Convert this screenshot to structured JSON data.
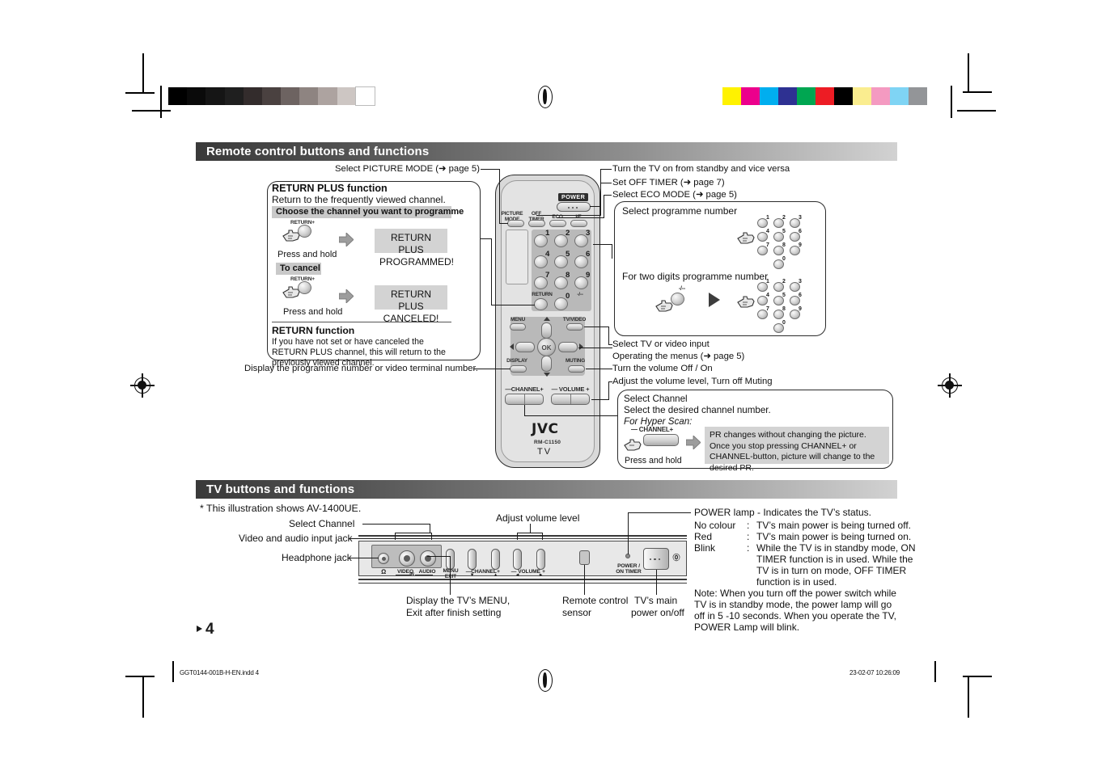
{
  "page": {
    "number": "4",
    "footer_file": "GGT0144-001B-H-EN.indd   4",
    "footer_timestamp": "23-02-07   10:26:09"
  },
  "sections": {
    "remote": {
      "title": "Remote control buttons and functions"
    },
    "tv": {
      "title": "TV buttons and functions"
    }
  },
  "remote_callouts": {
    "picture_mode": "Select PICTURE MODE (➜ page 5)",
    "power": "Turn the TV on from standby and vice versa",
    "off_timer": "Set OFF TIMER (➜ page 7)",
    "eco_mode": "Select ECO MODE (➜ page 5)",
    "tv_video": "Select TV or video input",
    "menus": "Operating the menus (➜ page 5)",
    "muting": "Turn the volume Off / On",
    "volume": "Adjust the volume level, Turn off Muting",
    "display": "Display the programme number or video terminal number."
  },
  "return_plus_box": {
    "title": "RETURN PLUS function",
    "subtitle": "Return to the frequently viewed channel.",
    "band_choose": "Choose the channel you want to programme",
    "btn_label_1": "RETURN+",
    "press_hold_1": "Press and hold",
    "result_1_line1": "RETURN PLUS",
    "result_1_line2": "PROGRAMMED!",
    "band_cancel": "To cancel",
    "btn_label_2": "RETURN+",
    "press_hold_2": "Press and hold",
    "result_2_line1": "RETURN PLUS",
    "result_2_line2": "CANCELED!",
    "return_title": "RETURN function",
    "return_text": "If you have not set or have canceled the RETURN PLUS channel, this will return to the previously viewed channel."
  },
  "programme_box": {
    "title": "Select programme number",
    "two_digit_title": "For two digits programme number",
    "dash_key_label": "-/--",
    "keypad_digits": [
      "1",
      "2",
      "3",
      "4",
      "5",
      "6",
      "7",
      "8",
      "9",
      "0"
    ]
  },
  "channel_box": {
    "title": "Select Channel",
    "subtitle": "Select the desired channel number.",
    "hyper_scan": "For Hyper Scan:",
    "rocker_label": "— CHANNEL+",
    "press_hold": "Press and hold",
    "note": "PR changes without changing the picture. Once you stop pressing CHANNEL+ or CHANNEL-button, picture will change to the desired PR."
  },
  "remote_keys": {
    "power_tag": "POWER",
    "picture_mode_l1": "PICTURE",
    "picture_mode_l2": "MODE",
    "off_timer_l1": "OFF",
    "off_timer_l2": "TIMER",
    "eco": "ECO",
    "ie": "I/E",
    "return": "RETURN",
    "dash": "-/--",
    "menu": "MENU",
    "tv_video": "TV/VIDEO",
    "display": "DISPLAY",
    "muting": "MUTING",
    "ok": "OK",
    "channel_rocker": "—CHANNEL+",
    "volume_rocker": "— VOLUME +",
    "brand": "JVC",
    "model": "RM-C1150",
    "type": "TV",
    "digits": [
      {
        "d": "1"
      },
      {
        "d": "2"
      },
      {
        "d": "3"
      },
      {
        "d": "4"
      },
      {
        "d": "5"
      },
      {
        "d": "6"
      },
      {
        "d": "7"
      },
      {
        "d": "8"
      },
      {
        "d": "9"
      },
      {
        "d": "0"
      }
    ]
  },
  "tv_section": {
    "illustration_note": "* This illustration shows AV-1400UE.",
    "label_select_channel": "Select Channel",
    "label_video_audio": "Video and audio input jack",
    "label_headphone": "Headphone jack",
    "label_adjust_volume": "Adjust volume level",
    "label_menu_l1": "Display the TV’s MENU,",
    "label_menu_l2": "Exit after finish setting",
    "label_sensor_l1": "Remote control",
    "label_sensor_l2": "sensor",
    "label_mainpower_l1": "TV’s main",
    "label_mainpower_l2": "power on/off",
    "panel_labels": {
      "headphone_icon": "Ω",
      "video": "VIDEO",
      "in": "IN",
      "audio": "AUDIO",
      "menu_l1": "MENU",
      "menu_l2": "EXIT",
      "channel": "CHANNEL",
      "channel_minus": "—",
      "channel_plus": "+",
      "channel_down": "▼",
      "channel_up": "▲",
      "volume": "VOLUME",
      "volume_minus": "—",
      "volume_plus": "+",
      "volume_left": "◄",
      "volume_right": "►",
      "power_l1": "POWER /",
      "power_l2": "ON TIMER",
      "power_symbol": "⓪"
    }
  },
  "power_lamp": {
    "heading": "POWER lamp - Indicates the TV’s status.",
    "rows": [
      {
        "state": "No colour",
        "sep": ":",
        "desc": "TV’s main power is being turned off."
      },
      {
        "state": "Red",
        "sep": ":",
        "desc": "TV’s main power is being turned on."
      },
      {
        "state": "Blink",
        "sep": ":",
        "desc": "While the TV is in standby mode, ON"
      }
    ],
    "blink_cont_1": "TIMER function is in used. While the",
    "blink_cont_2": "TV is in turn on mode, OFF TIMER",
    "blink_cont_3": "function is in used.",
    "note_1": "Note: When you turn off the power switch while",
    "note_2": "TV is in standby mode, the power lamp will go",
    "note_3": "off in 5 -10 seconds. When you operate the TV,",
    "note_4": "POWER Lamp will blink."
  },
  "print_marks": {
    "gray_swatches": [
      "#000000",
      "#0a0a0a",
      "#151515",
      "#1f1f1f",
      "#332c2c",
      "#4a4140",
      "#6d6361",
      "#8e8481",
      "#ada3a0",
      "#cdc6c3",
      "#ffffff"
    ],
    "color_swatches": [
      "#fff200",
      "#ec008c",
      "#00aeef",
      "#2e3192",
      "#00a651",
      "#ed1c24",
      "#000000",
      "#faed8f",
      "#f49ac1",
      "#7fd4f4",
      "#939598"
    ]
  }
}
